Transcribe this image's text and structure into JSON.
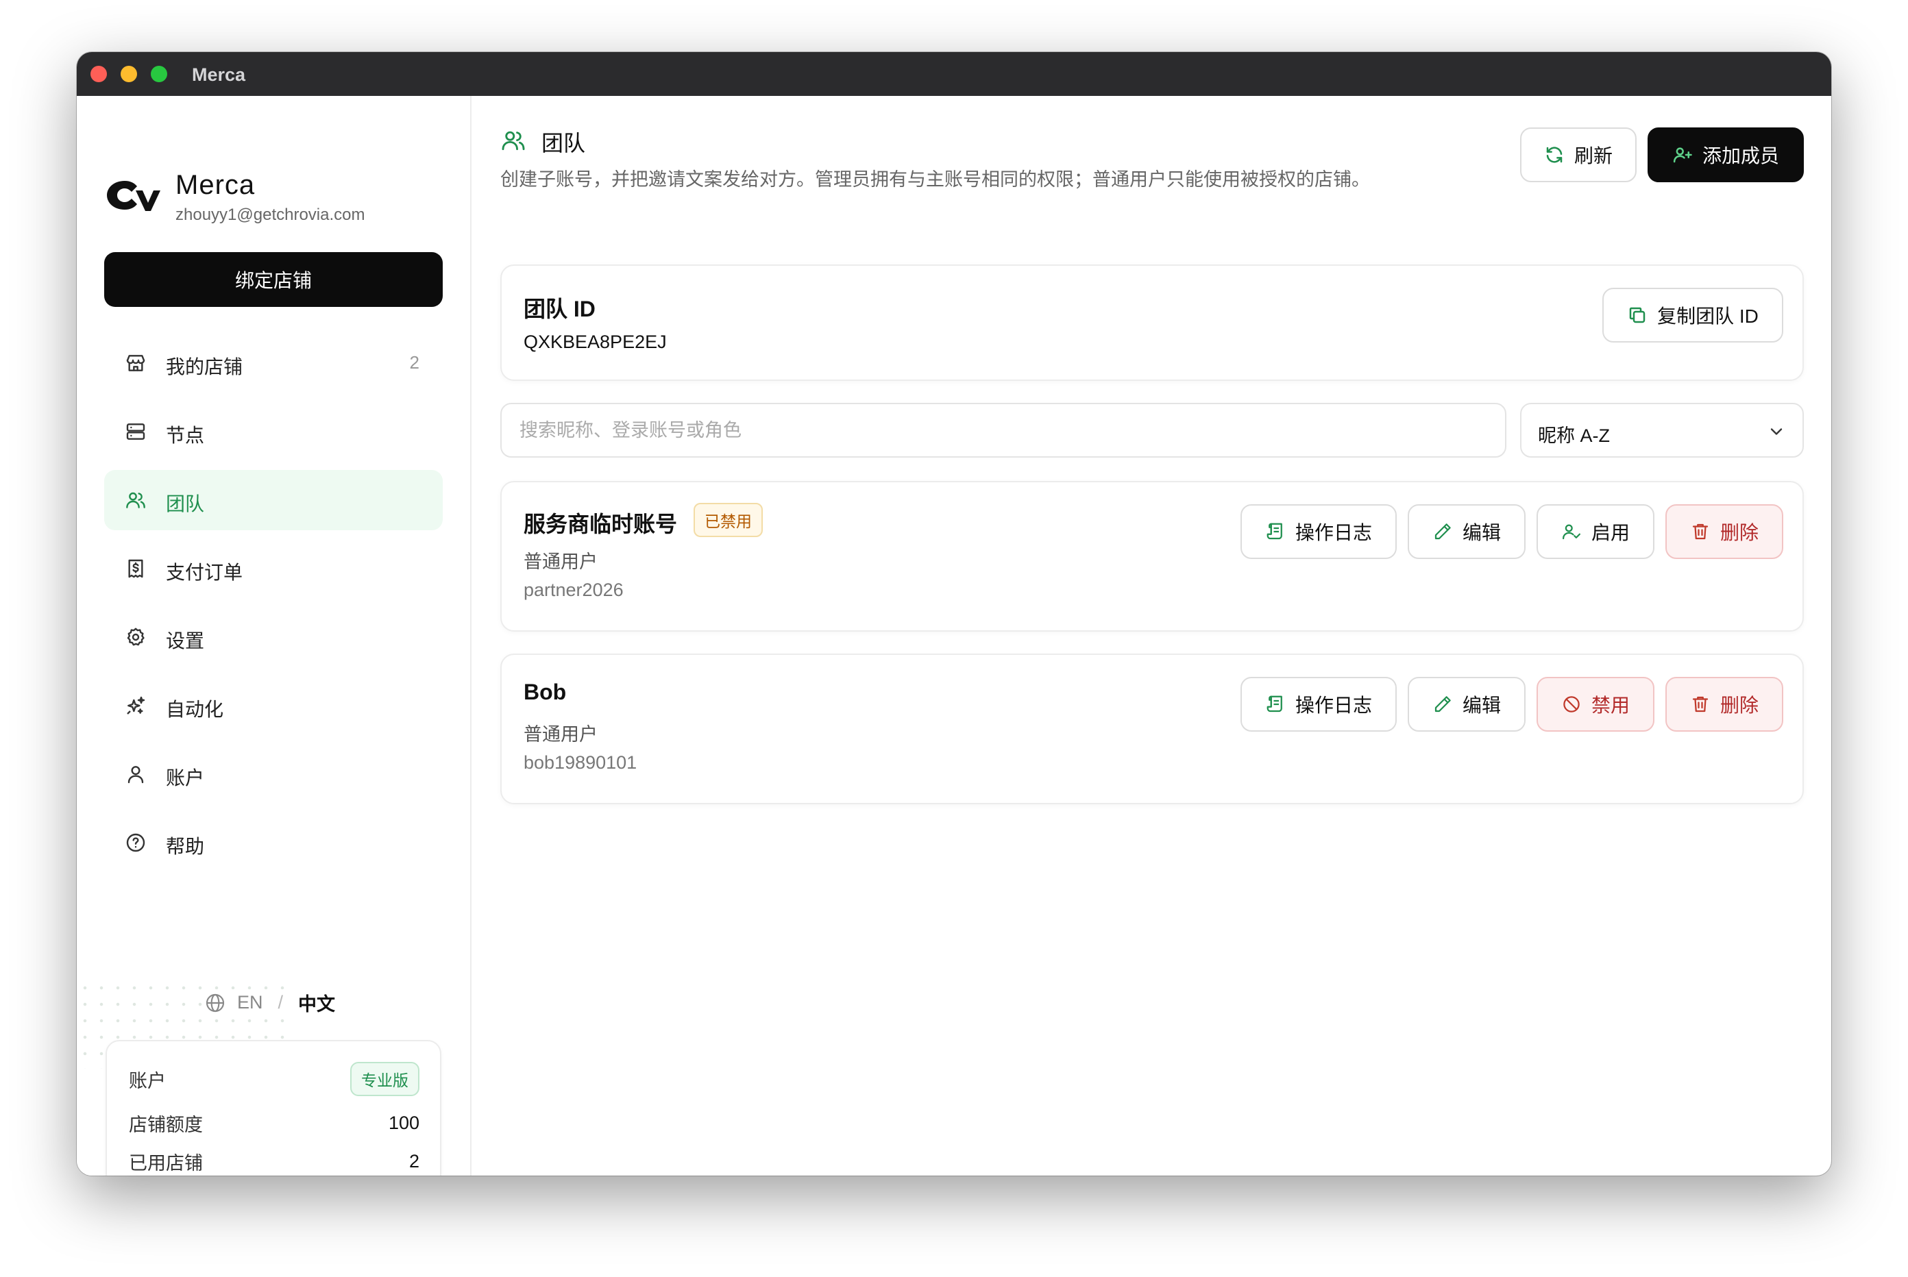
{
  "window": {
    "title": "Merca"
  },
  "sidebar": {
    "brand": "Merca",
    "email": "zhouyy1@getchrovia.com",
    "bind_button": "绑定店铺",
    "items": [
      {
        "label": "我的店铺",
        "count": "2",
        "icon": "store-icon"
      },
      {
        "label": "节点",
        "icon": "server-icon"
      },
      {
        "label": "团队",
        "icon": "users-icon",
        "active": true
      },
      {
        "label": "支付订单",
        "icon": "receipt-icon"
      },
      {
        "label": "设置",
        "icon": "gear-icon"
      },
      {
        "label": "自动化",
        "icon": "sparkles-icon"
      },
      {
        "label": "账户",
        "icon": "user-icon"
      },
      {
        "label": "帮助",
        "icon": "help-icon"
      }
    ],
    "language": {
      "en": "EN",
      "separator": "/",
      "zh": "中文"
    },
    "account_card": {
      "label": "账户",
      "plan": "专业版",
      "quota_label": "店铺额度",
      "quota_value": "100",
      "used_label": "已用店铺",
      "used_value": "2"
    }
  },
  "header": {
    "title": "团队",
    "description": "创建子账号，并把邀请文案发给对方。管理员拥有与主账号相同的权限；普通用户只能使用被授权的店铺。",
    "refresh": "刷新",
    "add_member": "添加成员"
  },
  "team_card": {
    "title": "团队 ID",
    "id": "QXKBEA8PE2EJ",
    "copy_button": "复制团队 ID"
  },
  "search": {
    "placeholder": "搜索昵称、登录账号或角色",
    "value": ""
  },
  "sort": {
    "selected": "昵称 A-Z"
  },
  "members": [
    {
      "name": "服务商临时账号",
      "badge": "已禁用",
      "role": "普通用户",
      "login": "partner2026",
      "actions": {
        "log": "操作日志",
        "edit": "编辑",
        "toggle": "启用",
        "delete": "删除"
      }
    },
    {
      "name": "Bob",
      "role": "普通用户",
      "login": "bob19890101",
      "actions": {
        "log": "操作日志",
        "edit": "编辑",
        "toggle": "禁用",
        "delete": "删除"
      }
    }
  ],
  "colors": {
    "accent": "#1f8f4e",
    "danger": "#b22a2a",
    "warning": "#b35a00",
    "titlebar": "#2b2b2d"
  }
}
